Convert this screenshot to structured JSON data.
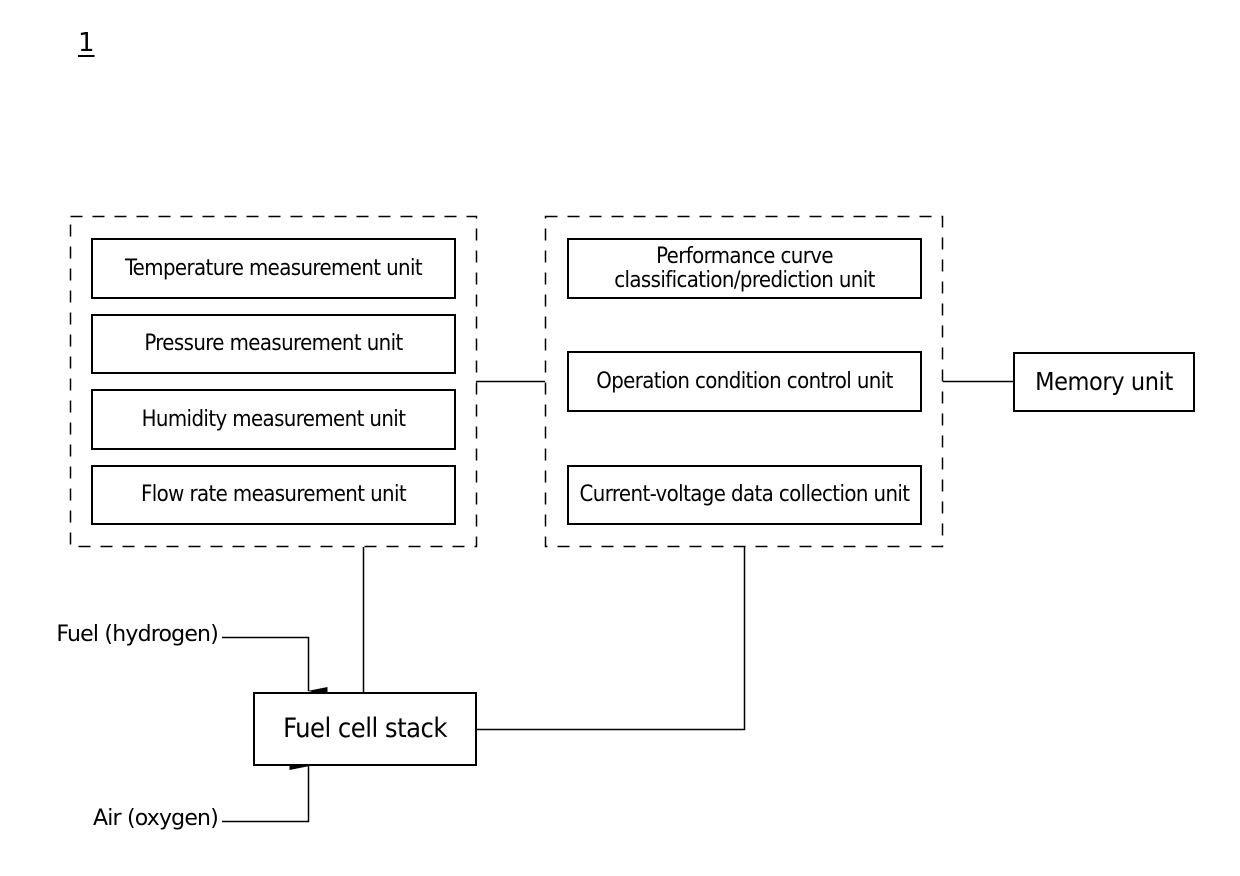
{
  "figure": {
    "number": "1"
  },
  "sensor_group": {
    "units": [
      {
        "label": "Temperature measurement unit"
      },
      {
        "label": "Pressure measurement unit"
      },
      {
        "label": "Humidity measurement unit"
      },
      {
        "label": "Flow rate measurement unit"
      }
    ]
  },
  "control_group": {
    "units": [
      {
        "label": "Performance curve classification/prediction unit"
      },
      {
        "label": "Operation condition control unit"
      },
      {
        "label": "Current-voltage data collection unit"
      }
    ]
  },
  "memory": {
    "label": "Memory unit"
  },
  "stack": {
    "label": "Fuel cell stack"
  },
  "inputs": {
    "fuel": "Fuel (hydrogen)",
    "air": "Air (oxygen)"
  },
  "colors": {
    "line": "#000000",
    "background": "#ffffff"
  }
}
